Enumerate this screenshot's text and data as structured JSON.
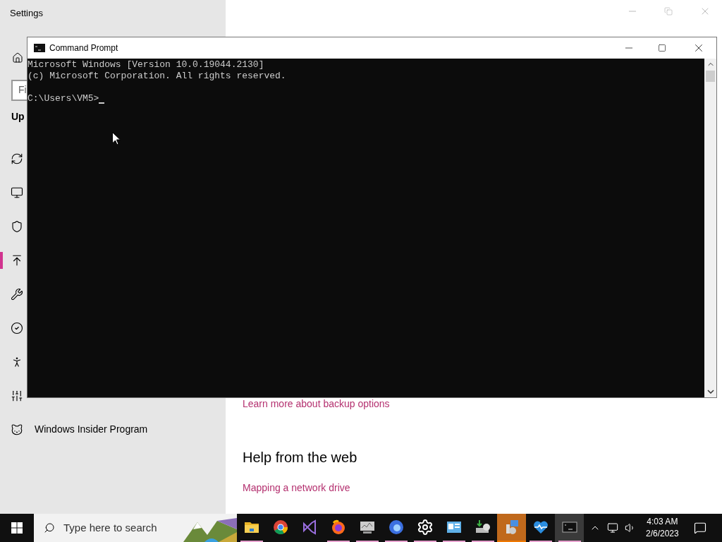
{
  "settings": {
    "title": "Settings",
    "search_placeholder": "Fi",
    "section": "Up",
    "nav": [
      {
        "selected": false
      },
      {
        "selected": false
      },
      {
        "selected": false
      },
      {
        "selected": true
      },
      {
        "selected": false
      },
      {
        "selected": false
      },
      {
        "selected": false
      },
      {
        "selected": false
      },
      {
        "selected": false,
        "label": "Windows Insider Program"
      }
    ],
    "content": [
      {
        "kind": "link",
        "text": "Learn more about backup options"
      },
      {
        "kind": "heading",
        "text": "Help from the web"
      },
      {
        "kind": "link",
        "text": "Mapping a network drive"
      }
    ]
  },
  "console": {
    "title": "Command Prompt",
    "lines": [
      "Microsoft Windows [Version 10.0.19044.2130]",
      "(c) Microsoft Corporation. All rights reserved."
    ],
    "prompt": "C:\\Users\\VM5>"
  },
  "taskbar": {
    "search_placeholder": "Type here to search",
    "apps": [
      {
        "running": true,
        "flashing": false,
        "selected": false
      },
      {
        "running": false,
        "flashing": false,
        "selected": false
      },
      {
        "running": false,
        "flashing": false,
        "selected": false
      },
      {
        "running": true,
        "flashing": false,
        "selected": false
      },
      {
        "running": true,
        "flashing": false,
        "selected": false
      },
      {
        "running": true,
        "flashing": false,
        "selected": false
      },
      {
        "running": true,
        "flashing": false,
        "selected": false
      },
      {
        "running": true,
        "flashing": false,
        "selected": false
      },
      {
        "running": true,
        "flashing": false,
        "selected": false
      },
      {
        "running": true,
        "flashing": true,
        "selected": false
      },
      {
        "running": true,
        "flashing": false,
        "selected": false
      },
      {
        "running": true,
        "flashing": false,
        "selected": true
      }
    ],
    "time": "4:03 AM",
    "date": "2/6/2023"
  }
}
